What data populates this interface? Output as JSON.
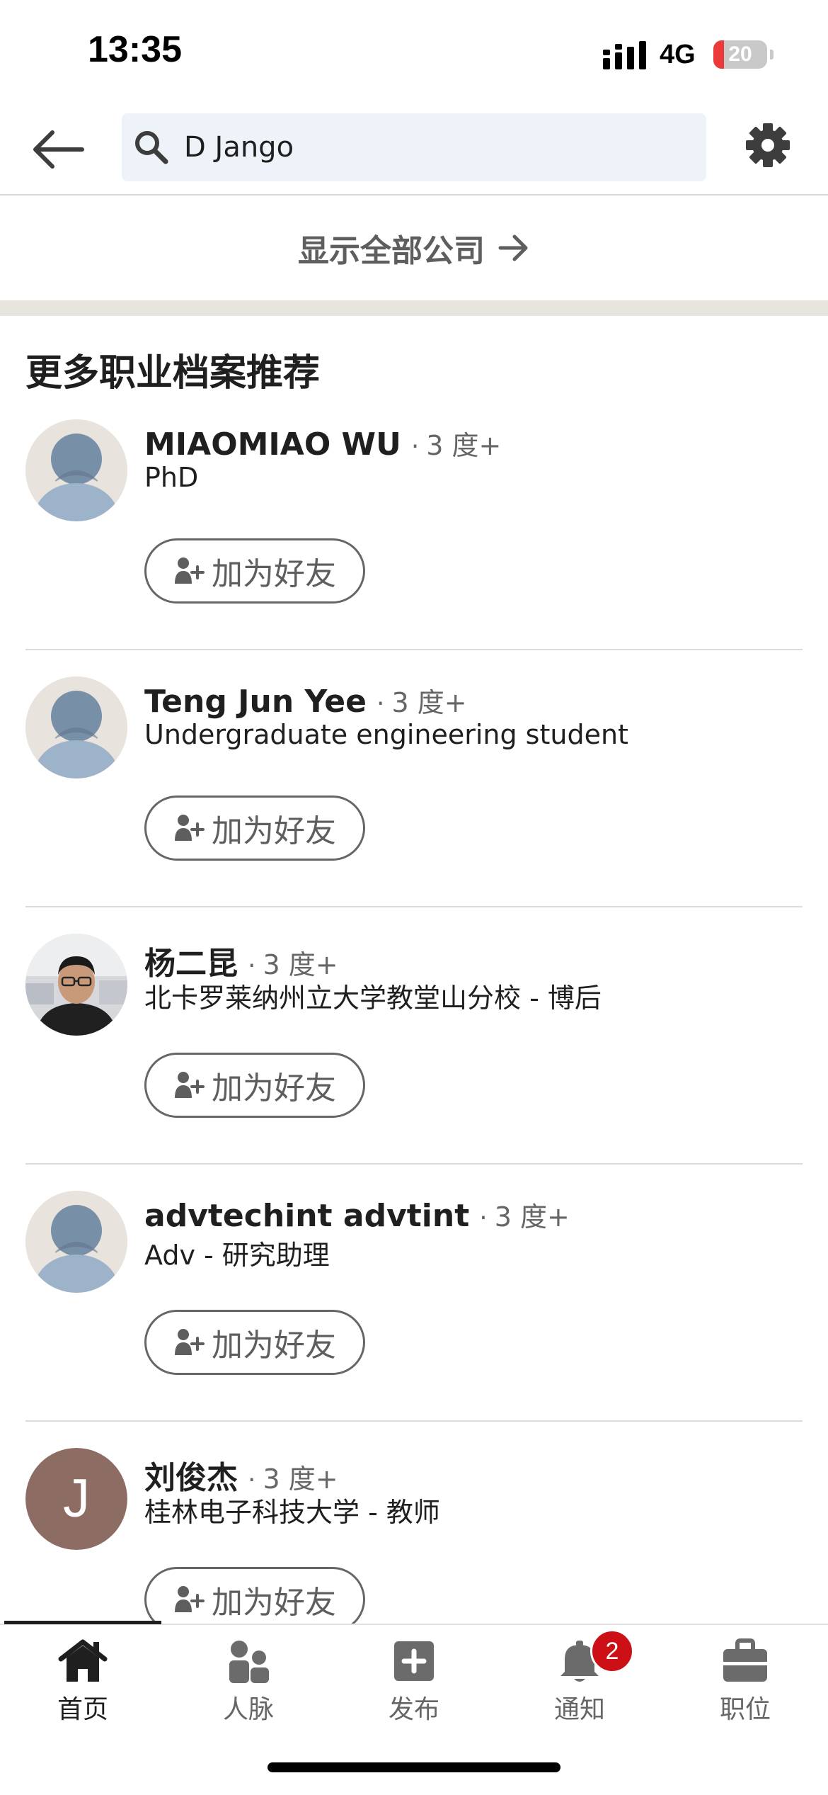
{
  "status_bar": {
    "time": "13:35",
    "network": "4G",
    "battery": "20"
  },
  "search": {
    "query": "D Jango"
  },
  "show_all": {
    "label": "显示全部公司"
  },
  "section": {
    "title": "更多职业档案推荐"
  },
  "profiles": [
    {
      "name": "MIAOMIAO WU",
      "degree": "3 度+",
      "headline": "PhD",
      "avatar": "default-avatar-icon",
      "button": "加为好友"
    },
    {
      "name": "Teng Jun Yee",
      "degree": "3 度+",
      "headline": "Undergraduate engineering student",
      "avatar": "default-avatar-icon",
      "button": "加为好友"
    },
    {
      "name": "杨二昆",
      "degree": "3 度+",
      "headline": "北卡罗莱纳州立大学教堂山分校 - 博后",
      "avatar": "photo",
      "button": "加为好友"
    },
    {
      "name": "advtechint advtint",
      "degree": "3 度+",
      "headline": "Adv - 研究助理",
      "avatar": "default-avatar-icon",
      "button": "加为好友"
    },
    {
      "name": "刘俊杰",
      "degree": "3 度+",
      "headline": "桂林电子科技大学 - 教师",
      "avatar": "letter",
      "avatar_letter": "J",
      "button": "加为好友"
    }
  ],
  "nav": {
    "home": "首页",
    "network": "人脉",
    "post": "发布",
    "notifications": "通知",
    "notifications_badge": "2",
    "jobs": "职位"
  },
  "colors": {
    "search_bg": "#edf3f8",
    "badge": "#cc1016",
    "battery_low": "#ea3a3a",
    "avatar_letter_bg": "#8d6d63"
  }
}
